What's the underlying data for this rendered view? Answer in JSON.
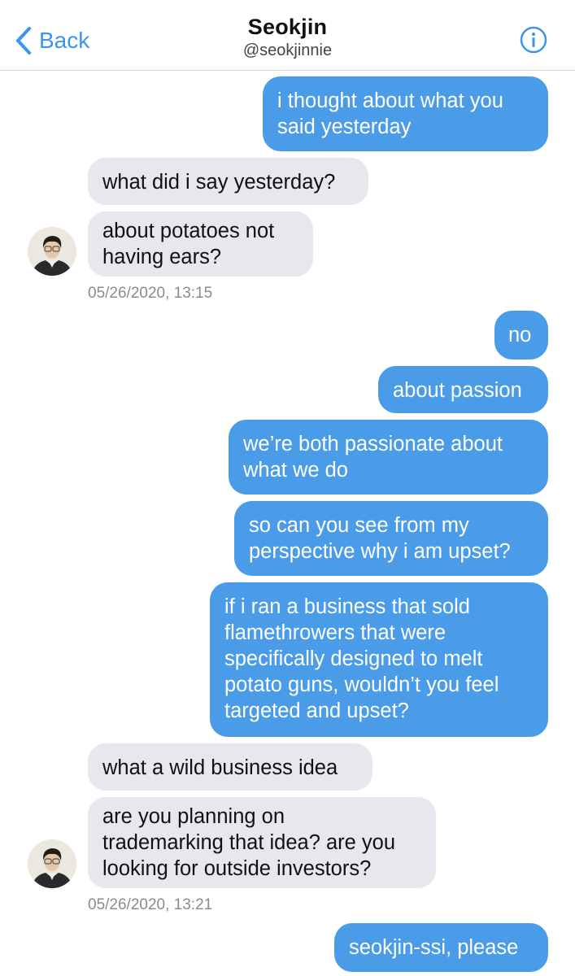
{
  "header": {
    "back_label": "Back",
    "title": "Seokjin",
    "handle": "@seokjinnie"
  },
  "messages": [
    {
      "dir": "out",
      "text": "i thought about what you\nsaid yesterday"
    },
    {
      "dir": "in",
      "text": "what did i say yesterday?"
    },
    {
      "dir": "in",
      "text": "about potatoes not\nhaving ears?"
    },
    {
      "dir": "out",
      "text": "no"
    },
    {
      "dir": "out",
      "text": "about passion"
    },
    {
      "dir": "out",
      "text": "we’re both passionate about\nwhat we do"
    },
    {
      "dir": "out",
      "text": "so can you see from my\nperspective why i am upset?"
    },
    {
      "dir": "out",
      "text": "if i ran a business that sold\nflamethrowers that were\nspecifically designed to melt\npotato guns, wouldn’t you feel\ntargeted and upset?"
    },
    {
      "dir": "in",
      "text": "what a wild business idea"
    },
    {
      "dir": "in",
      "text": "are you planning on\ntrademarking that idea? are you\nlooking for outside investors?"
    },
    {
      "dir": "out",
      "text": "seokjin-ssi, please"
    }
  ],
  "timestamps": [
    "05/26/2020, 13:15",
    "05/26/2020, 13:21"
  ],
  "colors": {
    "accent": "#3d94f0",
    "outgoing_bubble": "#4a9be8",
    "incoming_bubble": "#e7e8ee"
  },
  "icons": {
    "back": "chevron-left-icon",
    "info": "info-circle-icon",
    "avatar": "contact-avatar"
  }
}
